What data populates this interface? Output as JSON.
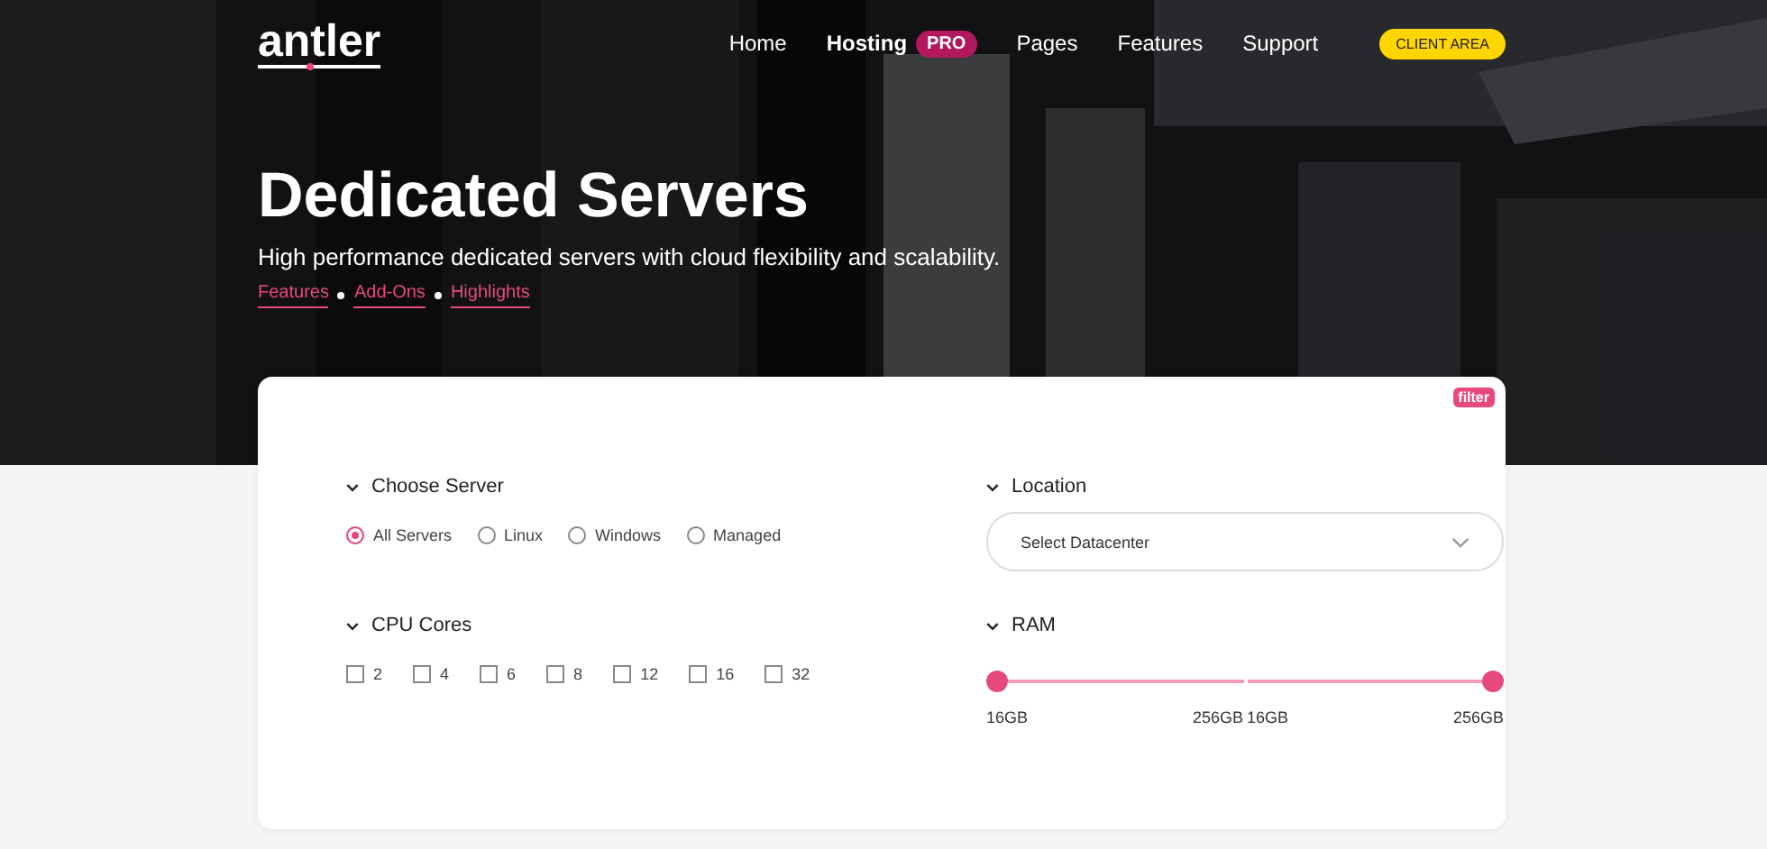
{
  "logo": "antler",
  "nav": [
    {
      "label": "Home",
      "selected": false
    },
    {
      "label": "Hosting",
      "selected": true,
      "badge": "PRO"
    },
    {
      "label": "Pages",
      "selected": false
    },
    {
      "label": "Features",
      "selected": false
    },
    {
      "label": "Support",
      "selected": false
    }
  ],
  "client_button": "CLIENT AREA",
  "hero": {
    "title": "Dedicated Servers",
    "subtitle": "High performance dedicated servers with cloud flexibility and scalability.",
    "links": [
      "Features",
      "Add-Ons",
      "Highlights"
    ]
  },
  "filter": {
    "tag": "filter",
    "choose_server": {
      "title": "Choose Server",
      "options": [
        {
          "label": "All Servers",
          "selected": true
        },
        {
          "label": "Linux",
          "selected": false
        },
        {
          "label": "Windows",
          "selected": false
        },
        {
          "label": "Managed",
          "selected": false
        }
      ]
    },
    "location": {
      "title": "Location",
      "placeholder": "Select Datacenter"
    },
    "cpu_cores": {
      "title": "CPU Cores",
      "options": [
        {
          "label": "2",
          "checked": false
        },
        {
          "label": "4",
          "checked": false
        },
        {
          "label": "6",
          "checked": false
        },
        {
          "label": "8",
          "checked": false
        },
        {
          "label": "12",
          "checked": false
        },
        {
          "label": "16",
          "checked": false
        },
        {
          "label": "32",
          "checked": false
        }
      ]
    },
    "ram": {
      "title": "RAM",
      "sliders": [
        {
          "level": 0,
          "min_label": "16GB",
          "max_label": "256GB"
        },
        {
          "level": 1,
          "min_label": "16GB",
          "max_label": "256GB"
        }
      ]
    }
  }
}
